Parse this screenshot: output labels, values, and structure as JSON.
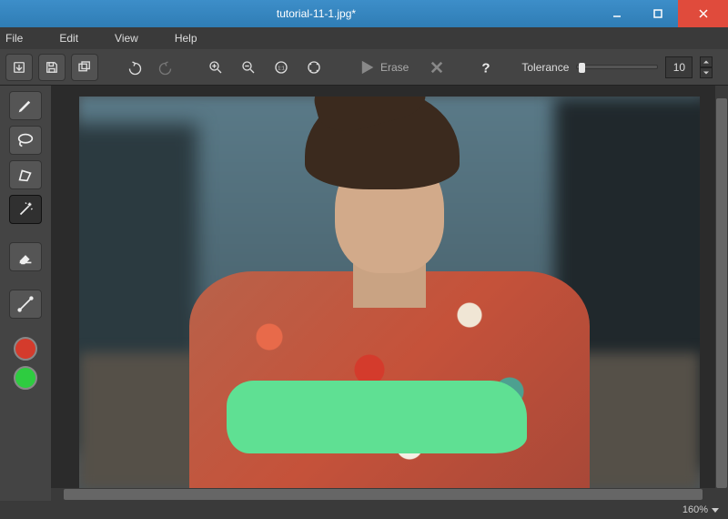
{
  "title": "tutorial-11-1.jpg*",
  "menubar": [
    "File",
    "Edit",
    "View",
    "Help"
  ],
  "toolbar": {
    "erase_label": "Erase",
    "tolerance_label": "Tolerance",
    "tolerance_value": "10"
  },
  "sidebar": {
    "colors": {
      "top": "#d43b2c",
      "bottom": "#2ecc40"
    }
  },
  "status": {
    "zoom": "160%"
  }
}
